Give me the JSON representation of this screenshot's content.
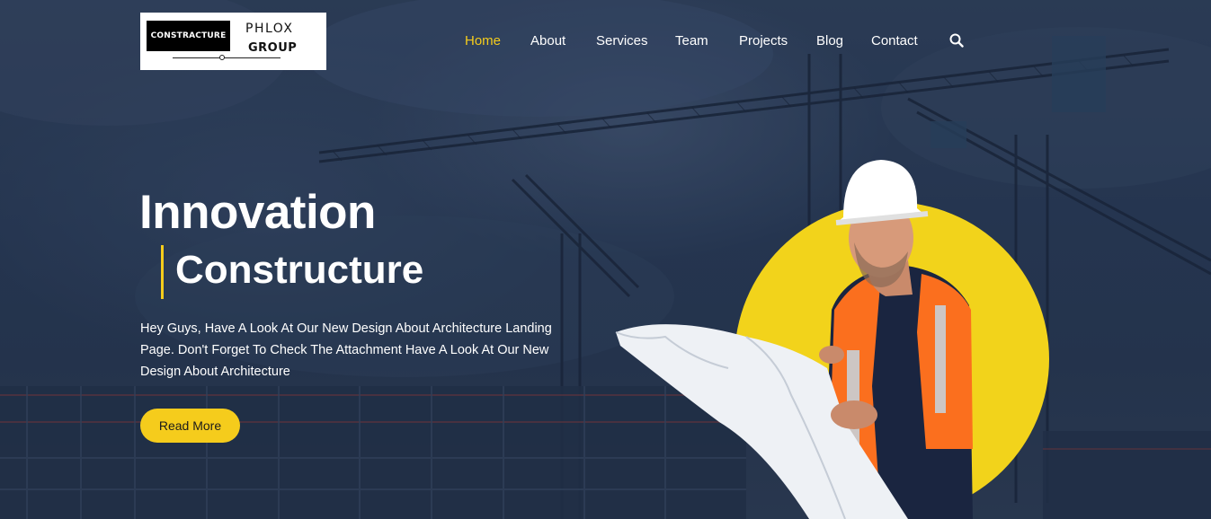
{
  "logo": {
    "badge_text": "CONSTRACTURE",
    "name_top": "PHLOX",
    "name_bottom": "GROUP"
  },
  "nav": {
    "items": [
      {
        "label": "Home",
        "active": true
      },
      {
        "label": "About",
        "active": false
      },
      {
        "label": "Services",
        "active": false
      },
      {
        "label": "Team",
        "active": false
      },
      {
        "label": "Projects",
        "active": false
      },
      {
        "label": "Blog",
        "active": false
      },
      {
        "label": "Contact",
        "active": false
      }
    ],
    "search_icon": "search-icon"
  },
  "hero": {
    "title_line1": "Innovation",
    "title_line2": "Constructure",
    "description": "Hey Guys, Have A Look At Our New Design About Architecture Landing Page. Don't Forget To Check The Attachment Have A Look At Our New Design About Architecture",
    "cta_label": "Read More",
    "hero_image": "construction-worker-with-blueprint"
  },
  "colors": {
    "accent": "#f5cc1c",
    "nav_active": "#f5cc1c",
    "text": "#ffffff",
    "background": "#2a3a52"
  }
}
